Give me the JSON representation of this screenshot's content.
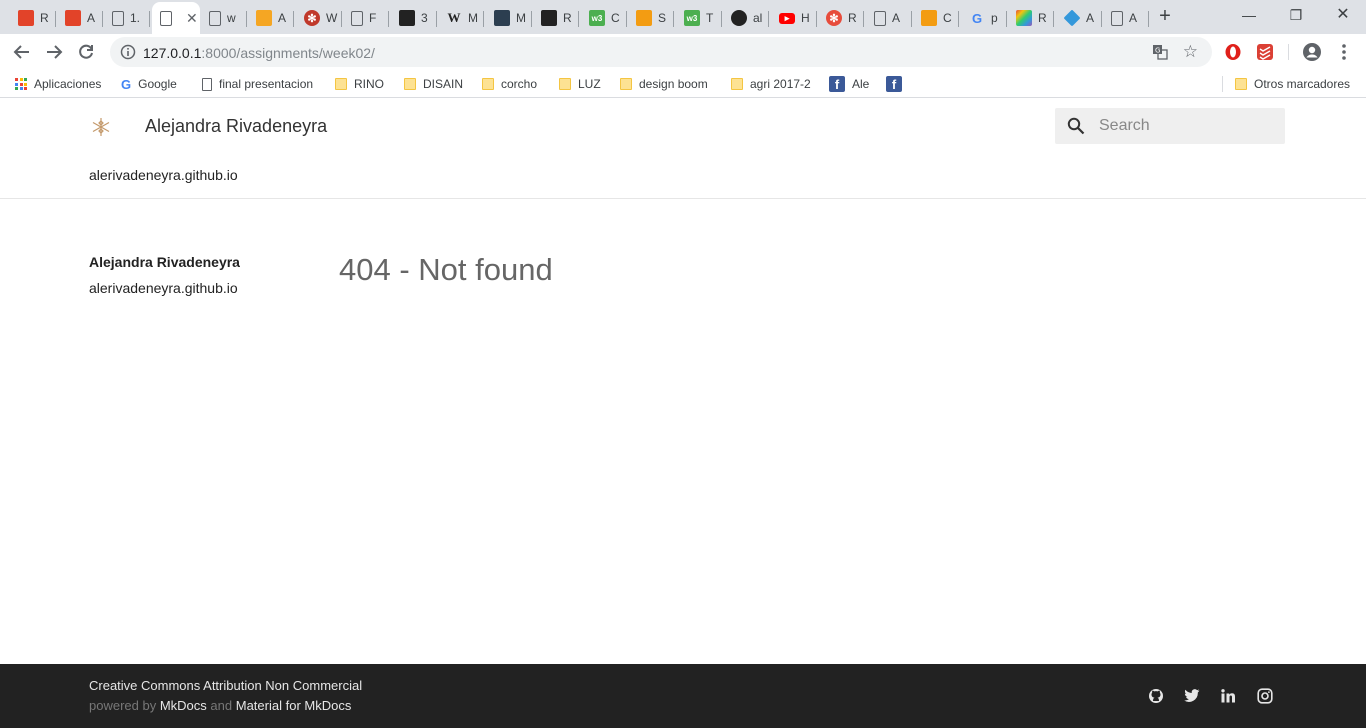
{
  "browser": {
    "tabs": [
      {
        "label": "R",
        "icon": "gitlab-icon",
        "color": "#e24329"
      },
      {
        "label": "A",
        "icon": "gitlab-icon",
        "color": "#e24329"
      },
      {
        "label": "1.",
        "icon": "page-icon",
        "color": "#5f6368"
      },
      {
        "label": "",
        "icon": "page-icon",
        "color": "#5f6368",
        "active": true
      },
      {
        "label": "w",
        "icon": "page-icon",
        "color": "#5f6368"
      },
      {
        "label": "A",
        "icon": "infinity-icon",
        "color": "#f5a623"
      },
      {
        "label": "W",
        "icon": "globe-icon",
        "color": "#c0392b"
      },
      {
        "label": "F",
        "icon": "page-icon",
        "color": "#5f6368"
      },
      {
        "label": "3",
        "icon": "graduation-cap-icon",
        "color": "#222222"
      },
      {
        "label": "M",
        "icon": "wikipedia-icon",
        "color": "#222222"
      },
      {
        "label": "M",
        "icon": "document-icon",
        "color": "#2c3e50"
      },
      {
        "label": "R",
        "icon": "book-icon",
        "color": "#222222"
      },
      {
        "label": "C",
        "icon": "w3-icon",
        "color": "#4caf50"
      },
      {
        "label": "S",
        "icon": "slash-icon",
        "color": "#f39c12"
      },
      {
        "label": "T",
        "icon": "w3-icon",
        "color": "#4caf50"
      },
      {
        "label": "al",
        "icon": "github-icon",
        "color": "#222222"
      },
      {
        "label": "H",
        "icon": "youtube-icon",
        "color": "#ff0000"
      },
      {
        "label": "R",
        "icon": "asterisk-icon",
        "color": "#e74c3c"
      },
      {
        "label": "A",
        "icon": "page-icon",
        "color": "#5f6368"
      },
      {
        "label": "C",
        "icon": "q-icon",
        "color": "#f39c12"
      },
      {
        "label": "p",
        "icon": "google-icon",
        "color": "#4285f4"
      },
      {
        "label": "R",
        "icon": "grid-color-icon",
        "color": "#9b59b6"
      },
      {
        "label": "A",
        "icon": "diamond-icon",
        "color": "#3498db"
      },
      {
        "label": "A",
        "icon": "page-icon",
        "color": "#5f6368"
      }
    ],
    "close_glyph": "✕",
    "new_tab_glyph": "+",
    "url_host": "127.0.0.1",
    "url_path": ":8000/assignments/week02/",
    "bookmarks": [
      {
        "label": "Aplicaciones",
        "icon": "apps-icon"
      },
      {
        "label": "Google",
        "icon": "google-icon"
      },
      {
        "label": "final presentacion",
        "icon": "page-icon"
      },
      {
        "label": "RINO",
        "icon": "folder-icon"
      },
      {
        "label": "DISAIN",
        "icon": "folder-icon"
      },
      {
        "label": "corcho",
        "icon": "folder-icon"
      },
      {
        "label": "LUZ",
        "icon": "folder-icon"
      },
      {
        "label": "design boom",
        "icon": "folder-icon"
      },
      {
        "label": "agri 2017-2",
        "icon": "folder-icon"
      },
      {
        "label": "Ale",
        "icon": "facebook-icon"
      },
      {
        "label": "",
        "icon": "facebook-icon"
      }
    ],
    "other_bookmarks": "Otros marcadores"
  },
  "site": {
    "title": "Alejandra Rivadeneyra",
    "repo": "alerivadeneyra.github.io",
    "search_placeholder": "Search",
    "sidebar_title": "Alejandra Rivadeneyra",
    "sidebar_repo": "alerivadeneyra.github.io",
    "content_title": "404 - Not found",
    "footer": {
      "license": "Creative Commons Attribution Non Commercial",
      "powered_prefix": "powered by",
      "mkdocs": "MkDocs",
      "and": "and",
      "material": "Material for MkDocs"
    },
    "accent_color": "#e6e6e6",
    "footer_bg": "#222222"
  }
}
